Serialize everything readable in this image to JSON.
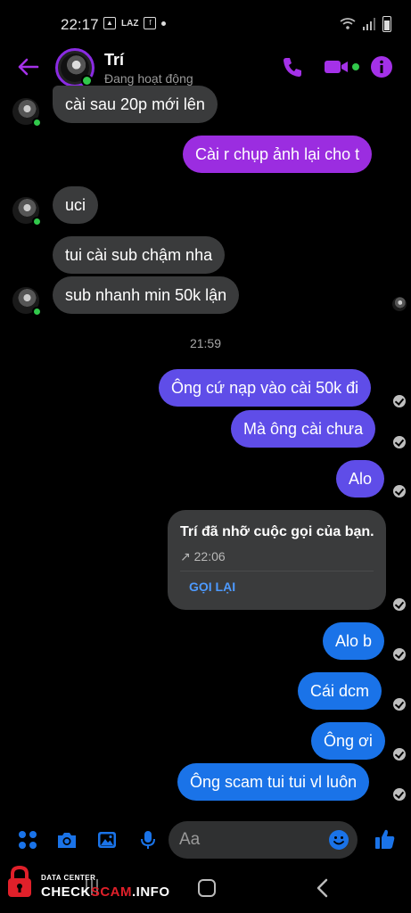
{
  "status_bar": {
    "time": "22:17",
    "lz": "LAZ"
  },
  "header": {
    "name": "Trí",
    "status": "Đang hoạt động"
  },
  "messages": [
    {
      "side": "in",
      "text": "cài sau 20p mới lên"
    },
    {
      "side": "out",
      "text": "Cài r chụp ảnh lại cho t"
    },
    {
      "side": "in",
      "text": "uci"
    },
    {
      "side": "in",
      "text": "tui cài sub chậm nha"
    },
    {
      "side": "in",
      "text": "sub nhanh min 50k lận"
    },
    {
      "side": "out",
      "text": "Ông cứ nạp vào cài 50k đi"
    },
    {
      "side": "out",
      "text": "Mà ông cài chưa"
    },
    {
      "side": "out",
      "text": "Alo"
    },
    {
      "side": "out",
      "text": "Alo b"
    },
    {
      "side": "out",
      "text": "Cái dcm"
    },
    {
      "side": "out",
      "text": "Ông ơi"
    },
    {
      "side": "out",
      "text": "Ông scam tui tui vl luôn"
    }
  ],
  "timestamp": "21:59",
  "missed_call": {
    "title": "Trí đã nhỡ cuộc gọi của bạn.",
    "time": "↗ 22:06",
    "action": "GỌI LẠI"
  },
  "composer": {
    "placeholder": "Aa"
  },
  "watermark": {
    "small": "DATA CENTER",
    "check": "CHECK",
    "scam": "SCAM",
    "info": ".INFO"
  },
  "colors": {
    "accent": "#9b2de0",
    "incoming_bubble": "#3a3b3c",
    "online": "#31c84b",
    "link": "#4d9aff"
  }
}
